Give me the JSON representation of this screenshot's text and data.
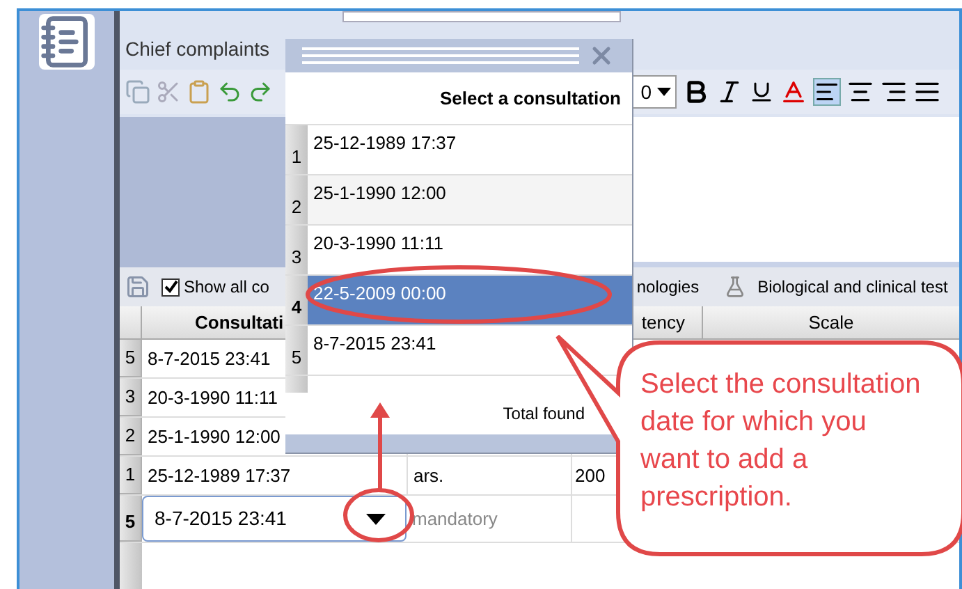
{
  "editor": {
    "label": "Chief complaints",
    "font_size": "0"
  },
  "bar": {
    "show_all": {
      "label": "Show all co",
      "checked": true
    },
    "tabs": [
      {
        "label": "nologies",
        "kind": "plain"
      },
      {
        "label": "Biological and clinical test",
        "kind": "flask"
      }
    ]
  },
  "table": {
    "columns": [
      "Consultati",
      "tency",
      "Scale"
    ],
    "rows": [
      {
        "index": "5",
        "date": "8-7-2015 23:41"
      },
      {
        "index": "3",
        "date": "20-3-1990 11:11"
      },
      {
        "index": "2",
        "date": "25-1-1990 12:00"
      },
      {
        "index": "1",
        "date": "25-12-1989 17:37",
        "column_2": "ars.",
        "column_3": "200"
      }
    ],
    "edit_row": {
      "index": "5",
      "value": "8-7-2015 23:41",
      "placeholder": "mandatory"
    }
  },
  "popup": {
    "title": "Select a consultation",
    "items": [
      {
        "index": "1",
        "date": "25-12-1989 17:37",
        "selected": false
      },
      {
        "index": "2",
        "date": "25-1-1990 12:00",
        "selected": false
      },
      {
        "index": "3",
        "date": "20-3-1990 11:11",
        "selected": false
      },
      {
        "index": "4",
        "date": "22-5-2009 00:00",
        "selected": true
      },
      {
        "index": "5",
        "date": "8-7-2015 23:41",
        "selected": false
      }
    ],
    "footer": "Total found"
  },
  "callout": {
    "text": "Select the consultation date for which you want to add a prescription."
  }
}
